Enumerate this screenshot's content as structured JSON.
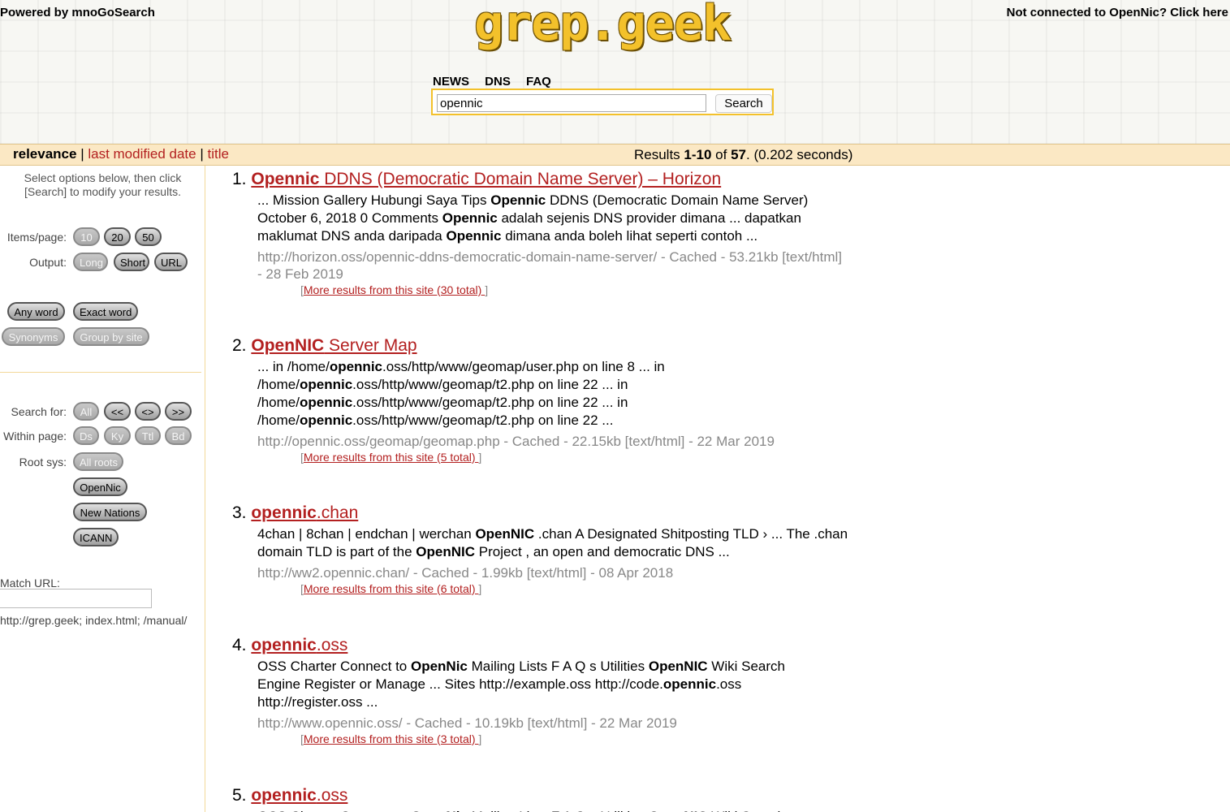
{
  "header": {
    "powered_by": "Powered by mnoGoSearch",
    "logo": "grep.geek",
    "not_connected": "Not connected to OpenNic? Click here",
    "nav": [
      "NEWS",
      "DNS",
      "FAQ"
    ]
  },
  "search": {
    "query": "opennic",
    "button_label": "Search"
  },
  "sortbar": {
    "relevance": "relevance",
    "separator": "|",
    "last_modified": "last modified date",
    "title": "title",
    "results_prefix": "Results ",
    "results_range": "1-10",
    "results_of": " of ",
    "results_total": "57",
    "results_suffix": ". (0.202 seconds)"
  },
  "sidebar": {
    "hint_line1": "Select options below, then click",
    "hint_line2": "[Search] to modify your results.",
    "items_page_label": "Items/page:",
    "items_page_options": [
      "10",
      "20",
      "50"
    ],
    "output_label": "Output:",
    "output_options": [
      "Long",
      "Short",
      "URL"
    ],
    "word_options": [
      "Any word",
      "Exact word"
    ],
    "group_options": [
      "Synonyms",
      "Group by site"
    ],
    "search_for_label": "Search for:",
    "search_for_options": [
      "All",
      "<<",
      "<>",
      ">>"
    ],
    "within_page_label": "Within page:",
    "within_page_options": [
      "Ds",
      "Ky",
      "Ttl",
      "Bd"
    ],
    "root_sys_label": "Root sys:",
    "root_sys_options": [
      "All roots",
      "OpenNic",
      "New Nations",
      "ICANN"
    ],
    "match_url_label": "Match URL:",
    "match_url_value": "",
    "url_examples": "http://grep.geek;  index.html;  /manual/"
  },
  "results": [
    {
      "number": "1.",
      "title_bold": "Opennic",
      "title_rest": " DDNS (Democratic Domain Name Server) – Horizon",
      "snippet": [
        {
          "t": "... Mission Gallery Hubungi Saya Tips "
        },
        {
          "b": "Opennic"
        },
        {
          "t": " DDNS (Democratic Domain Name Server) October 6, 2018 0 Comments "
        },
        {
          "b": "Opennic"
        },
        {
          "t": " adalah sejenis DNS provider dimana ... dapatkan maklumat DNS anda daripada "
        },
        {
          "b": "Opennic"
        },
        {
          "t": " dimana anda boleh lihat seperti contoh ..."
        }
      ],
      "url_line": "http://horizon.oss/opennic-ddns-democratic-domain-name-server/ - Cached - 53.21kb [text/html] - 28 Feb 2019",
      "more": "More results from this site (30 total) "
    },
    {
      "number": "2.",
      "title_bold": "OpenNIC",
      "title_rest": " Server Map",
      "snippet": [
        {
          "t": "... in /home/"
        },
        {
          "b": "opennic"
        },
        {
          "t": ".oss/http/www/geomap/user.php on line 8 ... in /home/"
        },
        {
          "b": "opennic"
        },
        {
          "t": ".oss/http/www/geomap/t2.php on line 22 ... in /home/"
        },
        {
          "b": "opennic"
        },
        {
          "t": ".oss/http/www/geomap/t2.php on line 22 ... in /home/"
        },
        {
          "b": "opennic"
        },
        {
          "t": ".oss/http/www/geomap/t2.php on line 22 ..."
        }
      ],
      "url_line": "http://opennic.oss/geomap/geomap.php - Cached - 22.15kb [text/html] - 22 Mar 2019",
      "more": "More results from this site (5 total) "
    },
    {
      "number": "3.",
      "title_bold": "opennic",
      "title_rest": ".chan",
      "snippet": [
        {
          "t": "4chan | 8chan | endchan | werchan "
        },
        {
          "b": "OpenNIC"
        },
        {
          "t": " .chan A Designated Shitposting TLD › ... The .chan domain TLD is part of the "
        },
        {
          "b": "OpenNIC"
        },
        {
          "t": " Project , an open and democratic DNS ..."
        }
      ],
      "url_line": "http://ww2.opennic.chan/ - Cached - 1.99kb [text/html] - 08 Apr 2018",
      "more": "More results from this site (6 total) "
    },
    {
      "number": "4.",
      "title_bold": "opennic",
      "title_rest": ".oss",
      "snippet": [
        {
          "t": "OSS Charter Connect to "
        },
        {
          "b": "OpenNic"
        },
        {
          "t": " Mailing Lists F A Q s Utilities "
        },
        {
          "b": "OpenNIC"
        },
        {
          "t": " Wiki Search Engine Register or Manage ... Sites http://example.oss http://code."
        },
        {
          "b": "opennic"
        },
        {
          "t": ".oss http://register.oss ..."
        }
      ],
      "url_line": "http://www.opennic.oss/ - Cached - 10.19kb [text/html] - 22 Mar 2019",
      "more": "More results from this site (3 total) "
    },
    {
      "number": "5.",
      "title_bold": "opennic",
      "title_rest": ".oss",
      "snippet": [
        {
          "t": "OSS Charter Connect to "
        },
        {
          "b": "OpenNic"
        },
        {
          "t": " Mailing Lists F A Q s Utilities "
        },
        {
          "b": "OpenNIC"
        },
        {
          "t": " Wiki Search"
        }
      ],
      "url_line": "",
      "more": ""
    }
  ],
  "colors": {
    "accent_red": "#b32020",
    "bar_bg": "#fbe8c4",
    "logo_gold": "#f3c12b"
  }
}
